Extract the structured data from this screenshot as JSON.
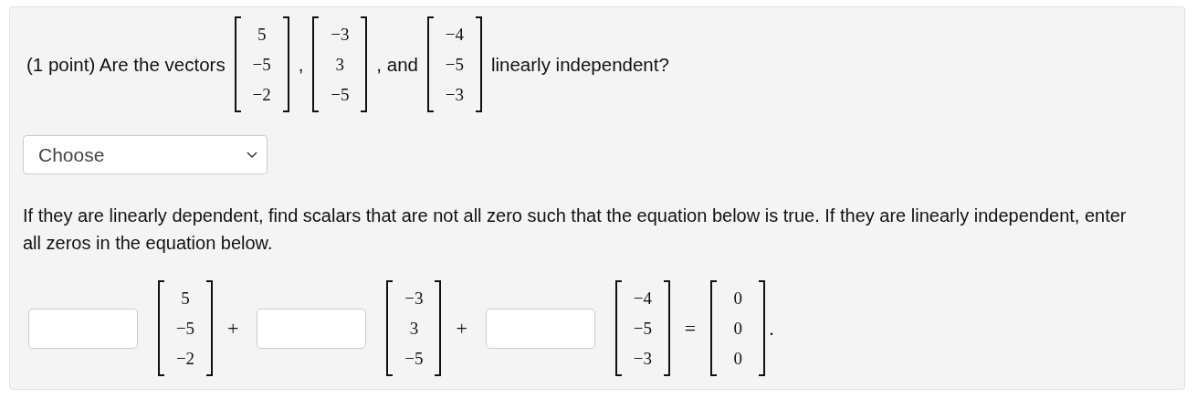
{
  "question": {
    "prefix": "(1 point) Are the vectors",
    "vectors": [
      [
        "5",
        "−5",
        "−2"
      ],
      [
        "−3",
        "3",
        "−5"
      ],
      [
        "−4",
        "−5",
        "−3"
      ]
    ],
    "separators": [
      ",",
      ", and"
    ],
    "suffix": "linearly independent?"
  },
  "select": {
    "value": "Choose"
  },
  "instructions": "If they are linearly dependent, find scalars that are not all zero such that the equation below is true. If they are linearly independent, enter all zeros in the equation below.",
  "equation": {
    "terms": [
      {
        "vector": [
          "5",
          "−5",
          "−2"
        ]
      },
      {
        "vector": [
          "−3",
          "3",
          "−5"
        ]
      },
      {
        "vector": [
          "−4",
          "−5",
          "−3"
        ]
      }
    ],
    "operators": [
      "+",
      "+"
    ],
    "equals": "=",
    "result": [
      "0",
      "0",
      "0"
    ],
    "end": "."
  }
}
